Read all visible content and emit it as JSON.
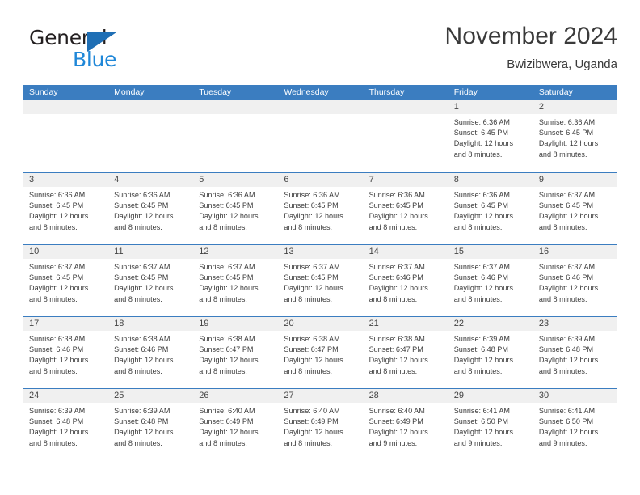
{
  "brand": {
    "name_part1": "General",
    "name_part2": "Blue",
    "triangle_color": "#1f6fb5",
    "blue_color": "#1f87d8"
  },
  "header": {
    "title": "November 2024",
    "subtitle": "Bwizibwera, Uganda"
  },
  "theme": {
    "header_blue": "#3b7dc0",
    "day_strip_gray": "#f0f0f0",
    "text_color": "#3c3c3c"
  },
  "weekdays": [
    "Sunday",
    "Monday",
    "Tuesday",
    "Wednesday",
    "Thursday",
    "Friday",
    "Saturday"
  ],
  "weeks": [
    [
      {
        "day": "",
        "sunrise": "",
        "sunset": "",
        "daylight_line1": "",
        "daylight_line2": ""
      },
      {
        "day": "",
        "sunrise": "",
        "sunset": "",
        "daylight_line1": "",
        "daylight_line2": ""
      },
      {
        "day": "",
        "sunrise": "",
        "sunset": "",
        "daylight_line1": "",
        "daylight_line2": ""
      },
      {
        "day": "",
        "sunrise": "",
        "sunset": "",
        "daylight_line1": "",
        "daylight_line2": ""
      },
      {
        "day": "",
        "sunrise": "",
        "sunset": "",
        "daylight_line1": "",
        "daylight_line2": ""
      },
      {
        "day": "1",
        "sunrise": "Sunrise: 6:36 AM",
        "sunset": "Sunset: 6:45 PM",
        "daylight_line1": "Daylight: 12 hours",
        "daylight_line2": "and 8 minutes."
      },
      {
        "day": "2",
        "sunrise": "Sunrise: 6:36 AM",
        "sunset": "Sunset: 6:45 PM",
        "daylight_line1": "Daylight: 12 hours",
        "daylight_line2": "and 8 minutes."
      }
    ],
    [
      {
        "day": "3",
        "sunrise": "Sunrise: 6:36 AM",
        "sunset": "Sunset: 6:45 PM",
        "daylight_line1": "Daylight: 12 hours",
        "daylight_line2": "and 8 minutes."
      },
      {
        "day": "4",
        "sunrise": "Sunrise: 6:36 AM",
        "sunset": "Sunset: 6:45 PM",
        "daylight_line1": "Daylight: 12 hours",
        "daylight_line2": "and 8 minutes."
      },
      {
        "day": "5",
        "sunrise": "Sunrise: 6:36 AM",
        "sunset": "Sunset: 6:45 PM",
        "daylight_line1": "Daylight: 12 hours",
        "daylight_line2": "and 8 minutes."
      },
      {
        "day": "6",
        "sunrise": "Sunrise: 6:36 AM",
        "sunset": "Sunset: 6:45 PM",
        "daylight_line1": "Daylight: 12 hours",
        "daylight_line2": "and 8 minutes."
      },
      {
        "day": "7",
        "sunrise": "Sunrise: 6:36 AM",
        "sunset": "Sunset: 6:45 PM",
        "daylight_line1": "Daylight: 12 hours",
        "daylight_line2": "and 8 minutes."
      },
      {
        "day": "8",
        "sunrise": "Sunrise: 6:36 AM",
        "sunset": "Sunset: 6:45 PM",
        "daylight_line1": "Daylight: 12 hours",
        "daylight_line2": "and 8 minutes."
      },
      {
        "day": "9",
        "sunrise": "Sunrise: 6:37 AM",
        "sunset": "Sunset: 6:45 PM",
        "daylight_line1": "Daylight: 12 hours",
        "daylight_line2": "and 8 minutes."
      }
    ],
    [
      {
        "day": "10",
        "sunrise": "Sunrise: 6:37 AM",
        "sunset": "Sunset: 6:45 PM",
        "daylight_line1": "Daylight: 12 hours",
        "daylight_line2": "and 8 minutes."
      },
      {
        "day": "11",
        "sunrise": "Sunrise: 6:37 AM",
        "sunset": "Sunset: 6:45 PM",
        "daylight_line1": "Daylight: 12 hours",
        "daylight_line2": "and 8 minutes."
      },
      {
        "day": "12",
        "sunrise": "Sunrise: 6:37 AM",
        "sunset": "Sunset: 6:45 PM",
        "daylight_line1": "Daylight: 12 hours",
        "daylight_line2": "and 8 minutes."
      },
      {
        "day": "13",
        "sunrise": "Sunrise: 6:37 AM",
        "sunset": "Sunset: 6:45 PM",
        "daylight_line1": "Daylight: 12 hours",
        "daylight_line2": "and 8 minutes."
      },
      {
        "day": "14",
        "sunrise": "Sunrise: 6:37 AM",
        "sunset": "Sunset: 6:46 PM",
        "daylight_line1": "Daylight: 12 hours",
        "daylight_line2": "and 8 minutes."
      },
      {
        "day": "15",
        "sunrise": "Sunrise: 6:37 AM",
        "sunset": "Sunset: 6:46 PM",
        "daylight_line1": "Daylight: 12 hours",
        "daylight_line2": "and 8 minutes."
      },
      {
        "day": "16",
        "sunrise": "Sunrise: 6:37 AM",
        "sunset": "Sunset: 6:46 PM",
        "daylight_line1": "Daylight: 12 hours",
        "daylight_line2": "and 8 minutes."
      }
    ],
    [
      {
        "day": "17",
        "sunrise": "Sunrise: 6:38 AM",
        "sunset": "Sunset: 6:46 PM",
        "daylight_line1": "Daylight: 12 hours",
        "daylight_line2": "and 8 minutes."
      },
      {
        "day": "18",
        "sunrise": "Sunrise: 6:38 AM",
        "sunset": "Sunset: 6:46 PM",
        "daylight_line1": "Daylight: 12 hours",
        "daylight_line2": "and 8 minutes."
      },
      {
        "day": "19",
        "sunrise": "Sunrise: 6:38 AM",
        "sunset": "Sunset: 6:47 PM",
        "daylight_line1": "Daylight: 12 hours",
        "daylight_line2": "and 8 minutes."
      },
      {
        "day": "20",
        "sunrise": "Sunrise: 6:38 AM",
        "sunset": "Sunset: 6:47 PM",
        "daylight_line1": "Daylight: 12 hours",
        "daylight_line2": "and 8 minutes."
      },
      {
        "day": "21",
        "sunrise": "Sunrise: 6:38 AM",
        "sunset": "Sunset: 6:47 PM",
        "daylight_line1": "Daylight: 12 hours",
        "daylight_line2": "and 8 minutes."
      },
      {
        "day": "22",
        "sunrise": "Sunrise: 6:39 AM",
        "sunset": "Sunset: 6:48 PM",
        "daylight_line1": "Daylight: 12 hours",
        "daylight_line2": "and 8 minutes."
      },
      {
        "day": "23",
        "sunrise": "Sunrise: 6:39 AM",
        "sunset": "Sunset: 6:48 PM",
        "daylight_line1": "Daylight: 12 hours",
        "daylight_line2": "and 8 minutes."
      }
    ],
    [
      {
        "day": "24",
        "sunrise": "Sunrise: 6:39 AM",
        "sunset": "Sunset: 6:48 PM",
        "daylight_line1": "Daylight: 12 hours",
        "daylight_line2": "and 8 minutes."
      },
      {
        "day": "25",
        "sunrise": "Sunrise: 6:39 AM",
        "sunset": "Sunset: 6:48 PM",
        "daylight_line1": "Daylight: 12 hours",
        "daylight_line2": "and 8 minutes."
      },
      {
        "day": "26",
        "sunrise": "Sunrise: 6:40 AM",
        "sunset": "Sunset: 6:49 PM",
        "daylight_line1": "Daylight: 12 hours",
        "daylight_line2": "and 8 minutes."
      },
      {
        "day": "27",
        "sunrise": "Sunrise: 6:40 AM",
        "sunset": "Sunset: 6:49 PM",
        "daylight_line1": "Daylight: 12 hours",
        "daylight_line2": "and 8 minutes."
      },
      {
        "day": "28",
        "sunrise": "Sunrise: 6:40 AM",
        "sunset": "Sunset: 6:49 PM",
        "daylight_line1": "Daylight: 12 hours",
        "daylight_line2": "and 9 minutes."
      },
      {
        "day": "29",
        "sunrise": "Sunrise: 6:41 AM",
        "sunset": "Sunset: 6:50 PM",
        "daylight_line1": "Daylight: 12 hours",
        "daylight_line2": "and 9 minutes."
      },
      {
        "day": "30",
        "sunrise": "Sunrise: 6:41 AM",
        "sunset": "Sunset: 6:50 PM",
        "daylight_line1": "Daylight: 12 hours",
        "daylight_line2": "and 9 minutes."
      }
    ]
  ]
}
